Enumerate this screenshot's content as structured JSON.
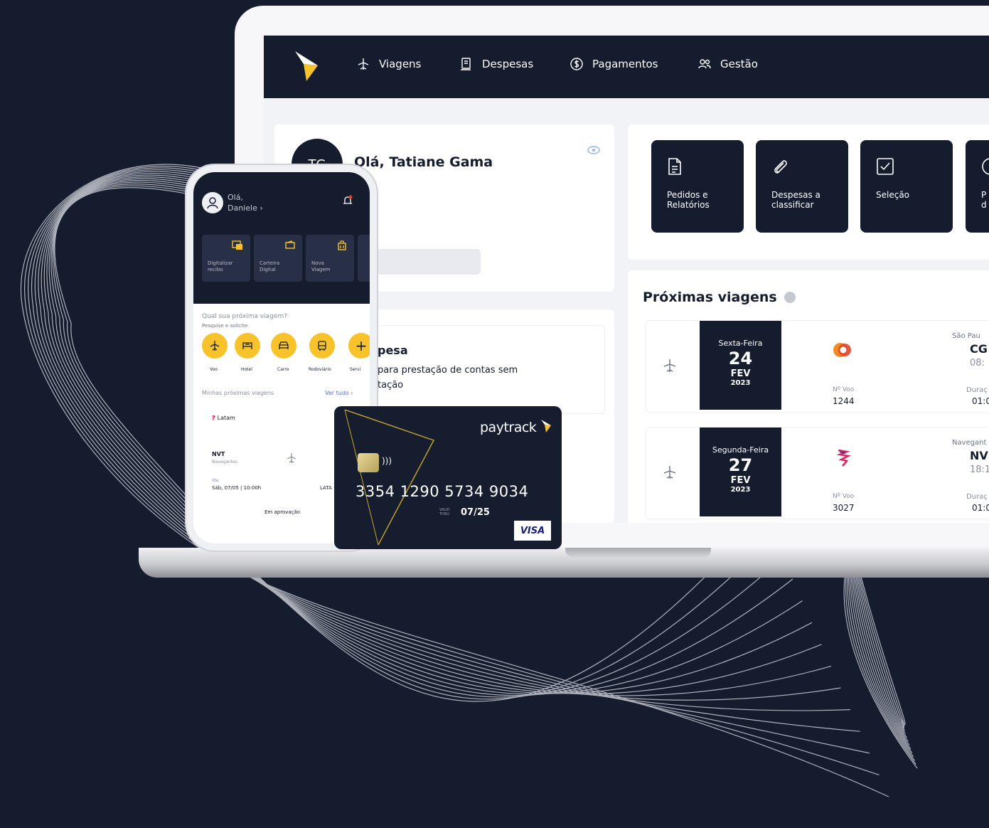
{
  "colors": {
    "background": "#151c2e",
    "accent": "#f8c22b",
    "panel": "#ffffff",
    "screen": "#f2f3f6"
  },
  "nav": {
    "items": [
      {
        "label": "Viagens",
        "icon": "plane-icon"
      },
      {
        "label": "Despesas",
        "icon": "receipt-icon"
      },
      {
        "label": "Pagamentos",
        "icon": "dollar-icon"
      },
      {
        "label": "Gestão",
        "icon": "users-icon"
      }
    ]
  },
  "greeting": {
    "avatar_initials": "TG",
    "text": "Olá, Tatiane Gama"
  },
  "expense": {
    "title": "pesa",
    "desc_line1": "para prestação de contas sem",
    "desc_line2": "tação"
  },
  "tiles": [
    {
      "label_line1": "Pedidos e",
      "label_line2": "Relatórios",
      "icon": "document-icon"
    },
    {
      "label_line1": "Despesas a",
      "label_line2": "classificar",
      "icon": "paperclip-icon"
    },
    {
      "label_line1": "Seleção",
      "label_line2": "",
      "icon": "checkbox-icon"
    },
    {
      "label_line1": "P",
      "label_line2": "d",
      "icon": "clock-icon"
    }
  ],
  "trips": {
    "title": "Próximas viagens",
    "flight_label": "Nº Voo",
    "duration_label": "Duraç",
    "rows": [
      {
        "weekday": "Sexta-Feira",
        "day": "24",
        "month": "FEV",
        "year": "2023",
        "flight": "1244",
        "city": "São Pau",
        "code": "CG",
        "time": "08:",
        "duration": "01:0"
      },
      {
        "weekday": "Segunda-Feira",
        "day": "27",
        "month": "FEV",
        "year": "2023",
        "flight": "3027",
        "city": "Navegant",
        "code": "NV",
        "time": "18:1",
        "duration": "01:0"
      }
    ]
  },
  "phone": {
    "greet_line1": "Olá,",
    "greet_line2": "Daniele",
    "tiles": [
      {
        "label_line1": "Digitalizar",
        "label_line2": "recibo"
      },
      {
        "label_line1": "Carteira",
        "label_line2": "Digital"
      },
      {
        "label_line1": "Nova",
        "label_line2": "Viagem"
      }
    ],
    "question": "Qual sua próxima viagem?",
    "question_sub": "Pesquise e solicite",
    "categories": [
      "Voo",
      "Hotel",
      "Carro",
      "Rodoviário",
      "Servi"
    ],
    "section": "Minhas próximas viagens",
    "see_all": "Ver tudo",
    "airline": "Latam",
    "code": "NVT",
    "code_sub": "Navegantes",
    "mini_label": "Ida",
    "date": "Sáb, 07/05 | 10:00h",
    "dest": "LATA",
    "status": "Em aprovação"
  },
  "card": {
    "brand": "paytrack",
    "number": "3354 1290  5734  9034",
    "valid_line1": "VALID",
    "valid_line2": "THRU",
    "expiry": "07/25",
    "network": "VISA"
  }
}
